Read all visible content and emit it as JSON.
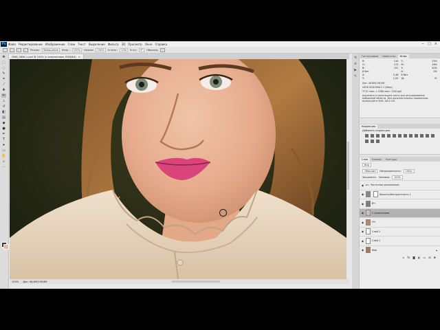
{
  "app": {
    "logo": "Ps"
  },
  "menu": [
    "Файл",
    "Редактирование",
    "Изображение",
    "Слои",
    "Текст",
    "Выделение",
    "Фильтр",
    "3D",
    "Просмотр",
    "Окно",
    "Справка"
  ],
  "window_controls": [
    "−",
    "□",
    "×"
  ],
  "options_bar": {
    "mode_label": "Замещение",
    "blend_label": "Режим:",
    "opacity_label": "Непр.:",
    "opacity_value": "100%",
    "flow_label": "Нажим:",
    "flow_value": "100%",
    "smoothing_label": "Сглаж.:",
    "smoothing_value": "10%",
    "angle_label": "Угол:",
    "angle_value": "0°",
    "sample_label": "Образец:"
  },
  "document": {
    "tab_title": "DMD_5806-1.psd @ 100% (с изменением, RGB/8#)",
    "zoom": "100%",
    "doc_size": "Док: 46,8М/136,8М"
  },
  "panels": {
    "top_tabs": [
      "Гистограмма",
      "Навигатор",
      "Инфо"
    ],
    "info": {
      "r_label": "R:",
      "r_value": "210",
      "g_label": "G:",
      "g_value": "172",
      "b_label": "B:",
      "b_value": "151",
      "c_label": "C:",
      "c_value": "15%",
      "m_label": "M:",
      "m_value": "36%",
      "y_label": "Y:",
      "y_value": "40%",
      "k_label": "K:",
      "k_value": "0%",
      "bits1": "8 бит",
      "bits2": "8 бит",
      "x_label": "X:",
      "x_value": "2,48",
      "y_pos_label": "Y:",
      "y_pos_value": "1,52",
      "w_label": "Ш:",
      "w_value": "",
      "h_label": "В:",
      "h_value": "",
      "doc_info": "Док: 46,8М/136,8М",
      "profile": "sRGB IEC61966-2.1 (8bpc)",
      "dims": "3712 пикс. x 5568 пикс. (300 ppi)",
      "hint": "Щелкните и перетащите кисть для ретуширования выбранной области. Для дополнительных параметров используйте Shift, Alt и Ctrl."
    },
    "adjustments": {
      "tab": "Коррекция",
      "title": "Добавить коррекцию"
    },
    "layers": {
      "tabs": [
        "Слои",
        "Каналы",
        "Контуры"
      ],
      "kind_label": "Вид",
      "blend_mode": "Обычные",
      "opacity_label": "Непрозрачность:",
      "opacity_value": "100%",
      "lock_label": "Закрепить:",
      "fill_label": "Заливка:",
      "fill_value": "100%",
      "items": [
        {
          "name": "Частотное разложение",
          "kind": "group"
        },
        {
          "name": "Яркость/Контрастность 1",
          "kind": "adjustment"
        },
        {
          "name": "ВЧ",
          "kind": "layer"
        },
        {
          "name": "С изменением",
          "kind": "layer",
          "selected": true
        },
        {
          "name": "НЧ",
          "kind": "layer"
        },
        {
          "name": "Слой 2",
          "kind": "layer"
        },
        {
          "name": "Слой 1",
          "kind": "layer"
        },
        {
          "name": "Фон",
          "kind": "background"
        }
      ],
      "bottom_icons": [
        "link-icon",
        "fx-icon",
        "mask-icon",
        "adjust-icon",
        "folder-icon",
        "new-layer-icon",
        "trash-icon"
      ]
    }
  }
}
